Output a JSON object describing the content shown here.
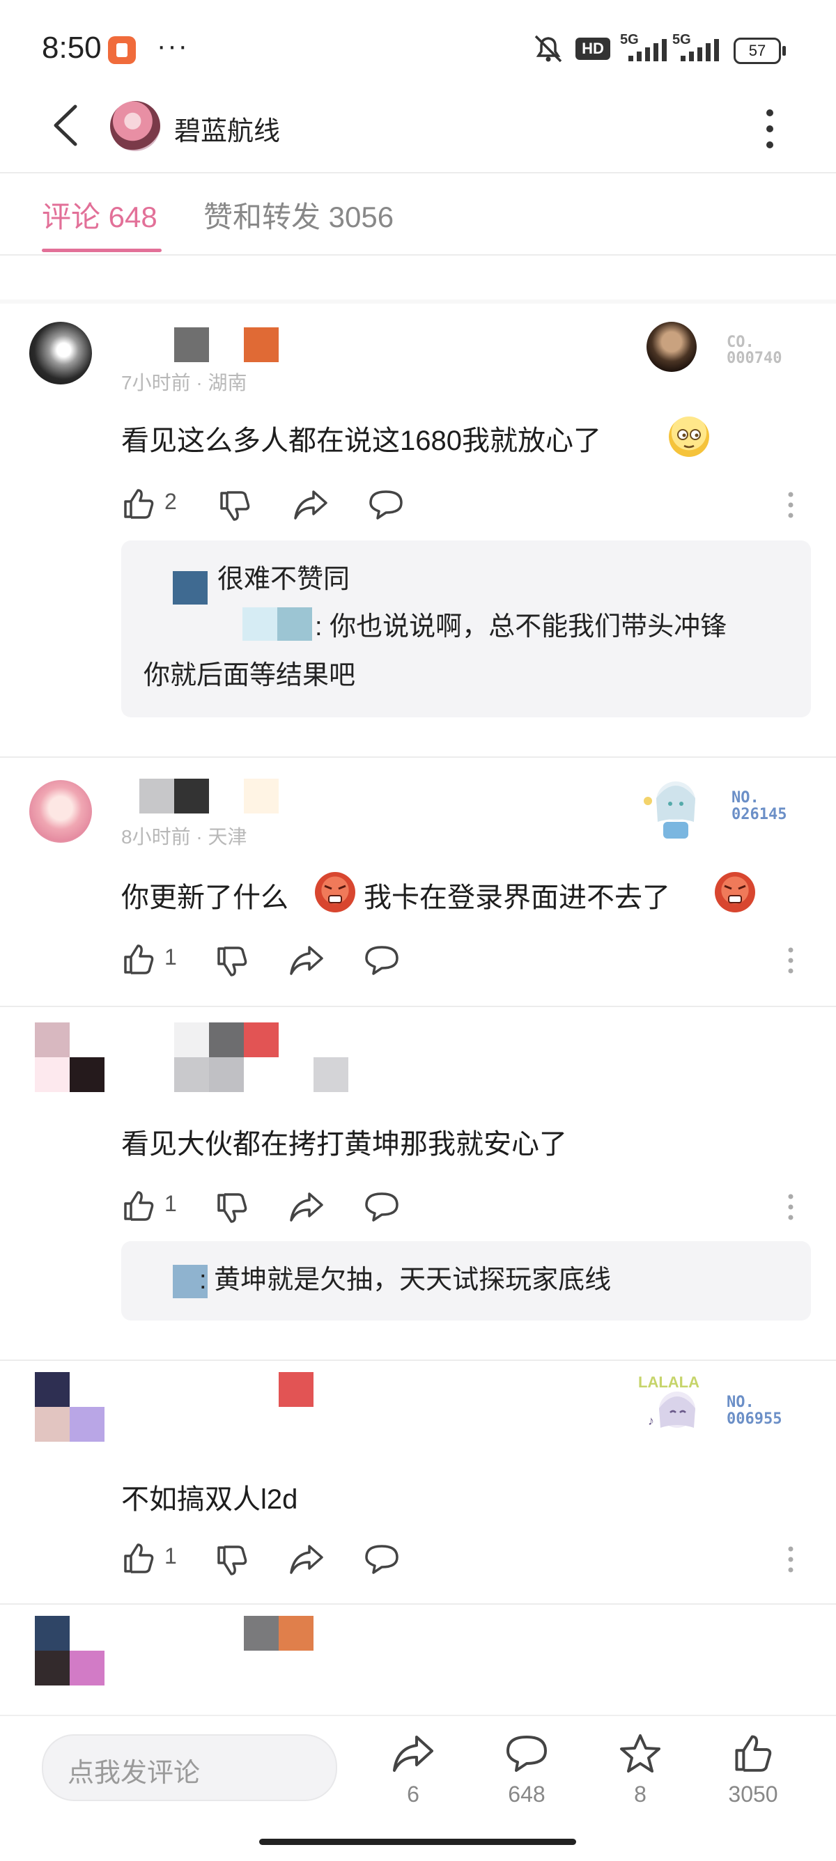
{
  "status_bar": {
    "time": "8:50",
    "more": "···",
    "hd": "HD",
    "net1": "5G",
    "net2": "5G",
    "battery": "57"
  },
  "header": {
    "title": "碧蓝航线"
  },
  "tabs": [
    {
      "label": "评论 648",
      "active": true
    },
    {
      "label": "赞和转发 3056",
      "active": false
    }
  ],
  "comments": [
    {
      "meta": "7小时前 · 湖南",
      "badge": {
        "label": "CO.",
        "number": "000740"
      },
      "text": "看见这么多人都在说这1680我就放心了",
      "likes": "2",
      "replies": [
        {
          "text": "很难不赞同"
        },
        {
          "text": ": 你也说说啊，总不能我们带头冲锋"
        },
        {
          "text": "你就后面等结果吧"
        }
      ]
    },
    {
      "meta": "8小时前 · 天津",
      "badge": {
        "label": "NO.",
        "number": "026145"
      },
      "text_a": "你更新了什么",
      "text_b": "我卡在登录界面进不去了",
      "likes": "1"
    },
    {
      "text": "看见大伙都在拷打黄坤那我就安心了",
      "likes": "1",
      "replies": [
        {
          "text": ": 黄坤就是欠抽，天天试探玩家底线"
        }
      ]
    },
    {
      "badge": {
        "label": "NO.",
        "number": "006955",
        "tag": "LALALA"
      },
      "text": "不如搞双人l2d",
      "likes": "1"
    }
  ],
  "bottom_bar": {
    "placeholder": "点我发评论",
    "share_count": "6",
    "comment_count": "648",
    "star_count": "8",
    "like_count": "3050"
  },
  "colors": {
    "accent": "#e27098",
    "badge_blue": "#6b8fc7",
    "reply_bg": "#f4f4f6"
  },
  "icons": [
    "back-icon",
    "more-vertical-icon",
    "thumbs-up-icon",
    "thumbs-down-icon",
    "share-icon",
    "comment-icon",
    "star-icon",
    "mute-icon",
    "signal-icon",
    "battery-icon"
  ]
}
